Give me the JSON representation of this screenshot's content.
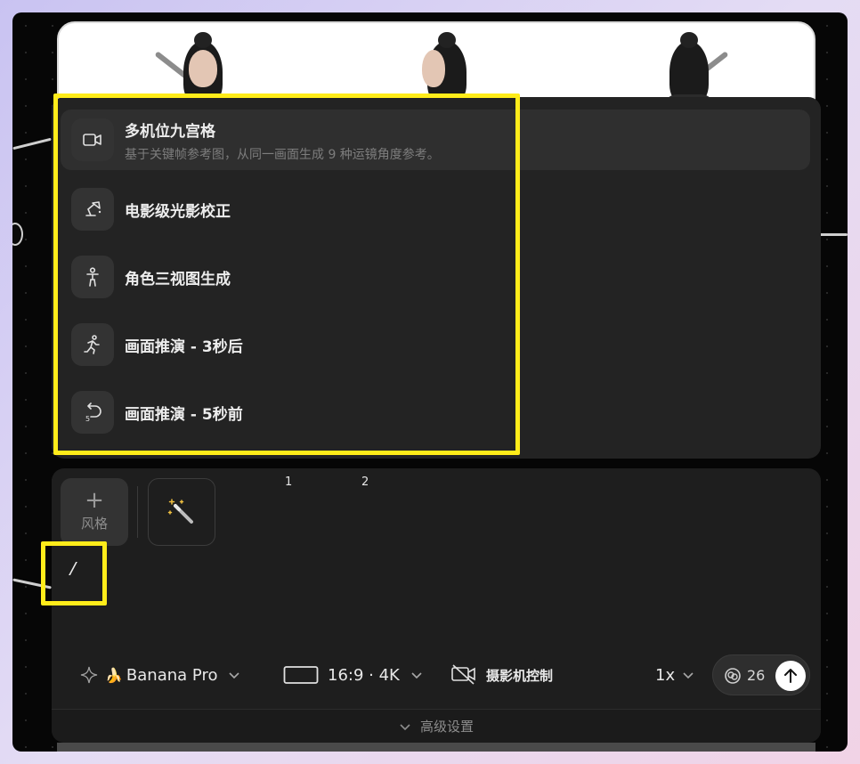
{
  "menu": {
    "items": [
      {
        "title": "多机位九宫格",
        "desc": "基于关键帧参考图，从同一画面生成 9 种运镜角度参考。",
        "icon": "video-camera-icon"
      },
      {
        "title": "电影级光影校正",
        "icon": "studio-lamp-icon"
      },
      {
        "title": "角色三视图生成",
        "icon": "person-icon"
      },
      {
        "title": "画面推演 - 3秒后",
        "icon": "running-person-icon"
      },
      {
        "title": "画面推演 - 5秒前",
        "icon": "rewind-5-icon"
      }
    ]
  },
  "composer": {
    "style_button": {
      "plus": "+",
      "label": "风格"
    },
    "step_labels": [
      "1",
      "2"
    ],
    "input_value": "/",
    "toolbar": {
      "model": {
        "emoji": "🍌",
        "label": "Banana Pro"
      },
      "aspect": {
        "label": "16:9 · 4K"
      },
      "camera": {
        "label": "摄影机控制"
      },
      "speed": {
        "label": "1x"
      },
      "credits": "26"
    },
    "advanced": {
      "label": "高级设置"
    }
  },
  "colors": {
    "highlight": "#ffec1a",
    "panel": "#232323",
    "composer": "#1e1e1e"
  }
}
